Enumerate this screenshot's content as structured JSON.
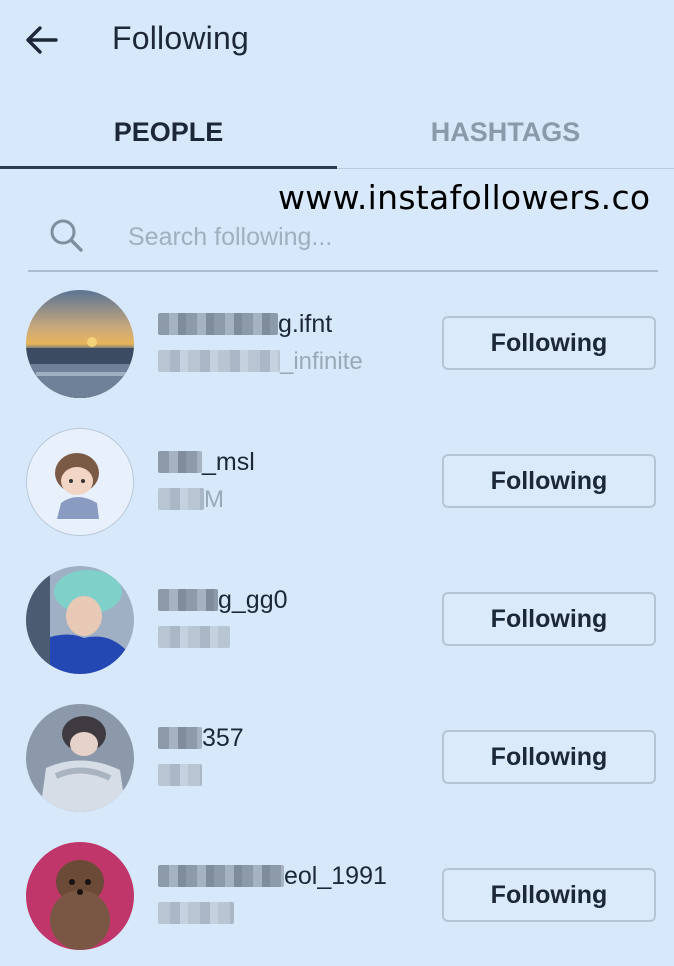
{
  "header": {
    "title": "Following",
    "back_icon": "arrow-left-icon"
  },
  "tabs": [
    {
      "label": "PEOPLE",
      "active": true
    },
    {
      "label": "HASHTAGS",
      "active": false
    }
  ],
  "watermark": "www.instafollowers.co",
  "search": {
    "placeholder": "Search following...",
    "value": "",
    "icon": "search-icon"
  },
  "people": [
    {
      "username_visible": "g.ifnt",
      "subtitle_visible": "_infinite",
      "button_label": "Following"
    },
    {
      "username_visible": "_msl",
      "subtitle_visible": "M",
      "button_label": "Following"
    },
    {
      "username_visible": "g_gg0",
      "subtitle_visible": "",
      "button_label": "Following"
    },
    {
      "username_visible": "357",
      "subtitle_visible": "",
      "button_label": "Following"
    },
    {
      "username_visible": "eol_1991",
      "subtitle_visible": "",
      "button_label": "Following"
    }
  ],
  "colors": {
    "background": "#d7e8fa",
    "text": "#1c2838",
    "muted": "#9aa9b8"
  }
}
